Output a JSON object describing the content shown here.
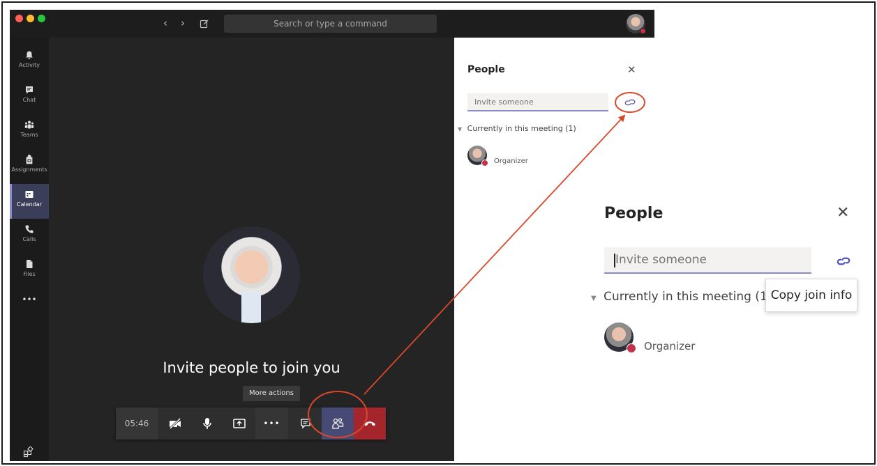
{
  "titlebar": {
    "search_placeholder": "Search or type a command",
    "window_controls": [
      "close",
      "minimize",
      "maximize"
    ]
  },
  "rail": {
    "items": [
      {
        "label": "Activity",
        "icon": "bell-icon"
      },
      {
        "label": "Chat",
        "icon": "chat-icon"
      },
      {
        "label": "Teams",
        "icon": "teams-icon"
      },
      {
        "label": "Assignments",
        "icon": "assignments-icon"
      },
      {
        "label": "Calendar",
        "icon": "calendar-icon",
        "active": true
      },
      {
        "label": "Calls",
        "icon": "phone-icon"
      },
      {
        "label": "Files",
        "icon": "file-icon"
      }
    ],
    "more": "•••"
  },
  "stage": {
    "invite_text": "Invite people to join you",
    "more_actions_tooltip": "More actions"
  },
  "callbar": {
    "timer": "05:46",
    "more_glyph": "•••"
  },
  "people_panel_small": {
    "title": "People",
    "close": "✕",
    "invite_placeholder": "Invite someone",
    "section": "Currently in this meeting (1)",
    "participant_role": "Organizer"
  },
  "people_panel_large": {
    "title": "People",
    "close": "✕",
    "invite_placeholder": "Invite someone",
    "section": "Currently in this meeting (1)",
    "copy_join_info_tooltip": "Copy join info",
    "participant_role": "Organizer"
  },
  "colors": {
    "accent": "#8b8cc7",
    "callbar_active": "#474a74",
    "hangup": "#a4262c",
    "status_busy": "#c4314b",
    "annotation": "#d9482b"
  }
}
